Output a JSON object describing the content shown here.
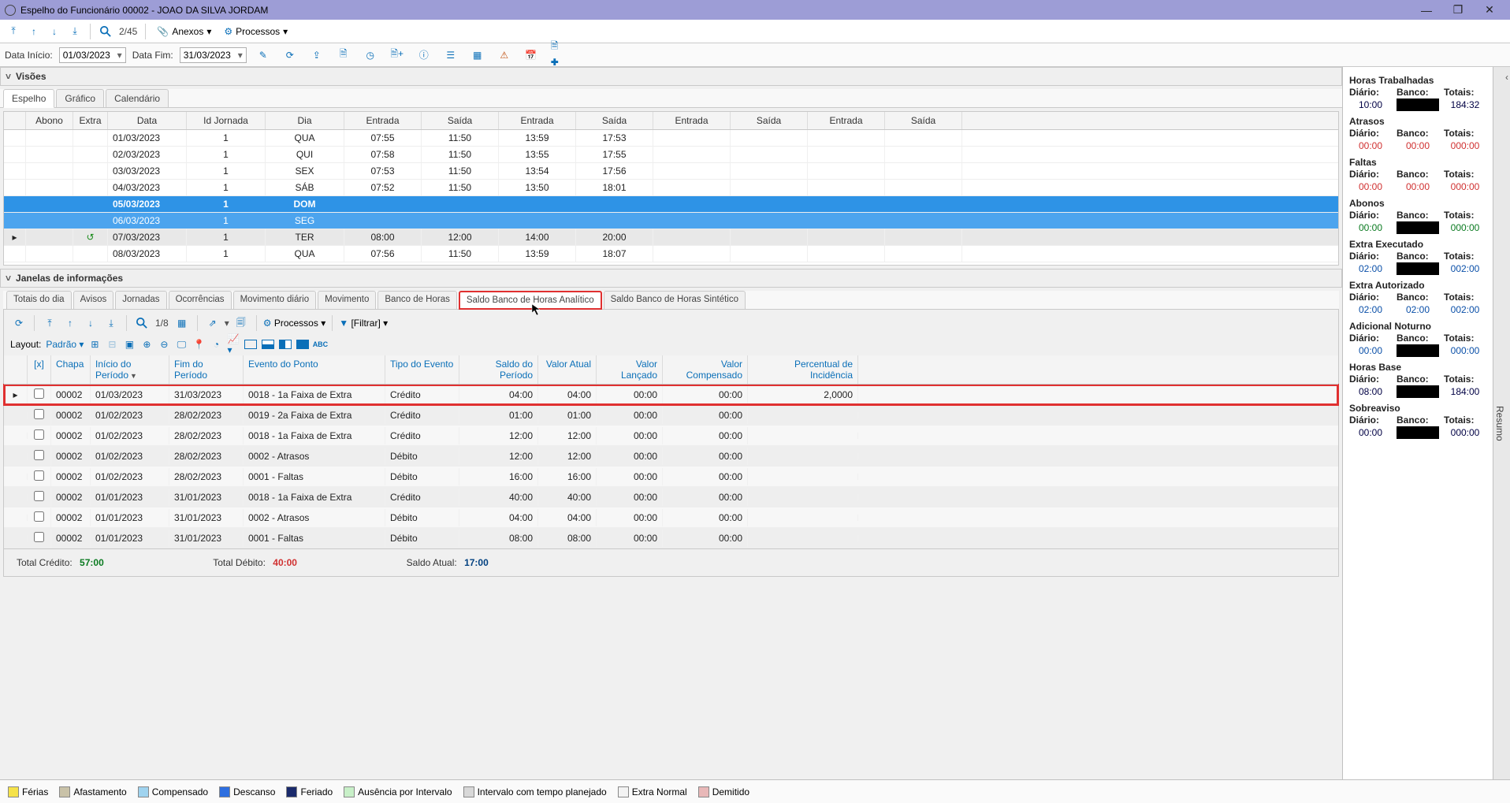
{
  "window": {
    "title": "Espelho do Funcionário 00002 - JOAO DA SILVA JORDAM"
  },
  "nav": {
    "counter": "2/45",
    "anexos": "Anexos",
    "processos": "Processos"
  },
  "dates": {
    "start_label": "Data Início:",
    "start": "01/03/2023",
    "end_label": "Data Fim:",
    "end": "31/03/2023"
  },
  "visoes": {
    "title": "Visões",
    "tabs": [
      "Espelho",
      "Gráfico",
      "Calendário"
    ],
    "columns": [
      "",
      "Abono",
      "Extra",
      "Data",
      "Id Jornada",
      "Dia",
      "Entrada",
      "Saída",
      "Entrada",
      "Saída",
      "Entrada",
      "Saída",
      "Entrada",
      "Saída"
    ],
    "rows": [
      {
        "marker": "",
        "abono": "",
        "extra": "",
        "data": "01/03/2023",
        "id": "1",
        "dia": "QUA",
        "t": [
          "07:55",
          "11:50",
          "13:59",
          "17:53",
          "",
          "",
          "",
          ""
        ]
      },
      {
        "marker": "",
        "abono": "",
        "extra": "",
        "data": "02/03/2023",
        "id": "1",
        "dia": "QUI",
        "t": [
          "07:58",
          "11:50",
          "13:55",
          "17:55",
          "",
          "",
          "",
          ""
        ]
      },
      {
        "marker": "",
        "abono": "",
        "extra": "",
        "data": "03/03/2023",
        "id": "1",
        "dia": "SEX",
        "t": [
          "07:53",
          "11:50",
          "13:54",
          "17:56",
          "",
          "",
          "",
          ""
        ]
      },
      {
        "marker": "",
        "abono": "",
        "extra": "",
        "data": "04/03/2023",
        "id": "1",
        "dia": "SÁB",
        "t": [
          "07:52",
          "11:50",
          "13:50",
          "18:01",
          "",
          "",
          "",
          ""
        ]
      },
      {
        "marker": "",
        "abono": "",
        "extra": "",
        "data": "05/03/2023",
        "id": "1",
        "dia": "DOM",
        "t": [
          "",
          "",
          "",
          "",
          "",
          "",
          "",
          ""
        ],
        "sel": 1
      },
      {
        "marker": "",
        "abono": "",
        "extra": "",
        "data": "06/03/2023",
        "id": "1",
        "dia": "SEG",
        "t": [
          "",
          "",
          "",
          "",
          "",
          "",
          "",
          ""
        ],
        "sel": 2
      },
      {
        "marker": "▸",
        "abono": "",
        "extra": "ico",
        "data": "07/03/2023",
        "id": "1",
        "dia": "TER",
        "t": [
          "08:00",
          "12:00",
          "14:00",
          "20:00",
          "",
          "",
          "",
          ""
        ],
        "cur": 1
      },
      {
        "marker": "",
        "abono": "",
        "extra": "",
        "data": "08/03/2023",
        "id": "1",
        "dia": "QUA",
        "t": [
          "07:56",
          "11:50",
          "13:59",
          "18:07",
          "",
          "",
          "",
          ""
        ]
      }
    ]
  },
  "janelas": {
    "title": "Janelas de informações",
    "tabs": [
      "Totais do dia",
      "Avisos",
      "Jornadas",
      "Ocorrências",
      "Movimento diário",
      "Movimento",
      "Banco de Horas",
      "Saldo Banco de Horas Analítico",
      "Saldo Banco de Horas Sintético"
    ],
    "active_tab": 7
  },
  "btoolbar": {
    "counter": "1/8",
    "processos": "Processos",
    "filtrar": "[Filtrar]",
    "layout_label": "Layout:",
    "layout_value": "Padrão"
  },
  "bgrid": {
    "columns": [
      "[x]",
      "Chapa",
      "Início do Período",
      "Fim do Período",
      "Evento do Ponto",
      "Tipo do Evento",
      "Saldo do Período",
      "Valor Atual",
      "Valor Lançado",
      "Valor Compensado",
      "Percentual de Incidência"
    ],
    "rows": [
      {
        "hi": 1,
        "chapa": "00002",
        "ini": "01/03/2023",
        "fim": "31/03/2023",
        "ev": "0018 - 1a Faixa de Extra",
        "tipo": "Crédito",
        "sp": "04:00",
        "va": "04:00",
        "vl": "00:00",
        "vc": "00:00",
        "pi": "2,0000"
      },
      {
        "chapa": "00002",
        "ini": "01/02/2023",
        "fim": "28/02/2023",
        "ev": "0019 - 2a Faixa de Extra",
        "tipo": "Crédito",
        "sp": "01:00",
        "va": "01:00",
        "vl": "00:00",
        "vc": "00:00",
        "pi": ""
      },
      {
        "chapa": "00002",
        "ini": "01/02/2023",
        "fim": "28/02/2023",
        "ev": "0018 - 1a Faixa de Extra",
        "tipo": "Crédito",
        "sp": "12:00",
        "va": "12:00",
        "vl": "00:00",
        "vc": "00:00",
        "pi": ""
      },
      {
        "chapa": "00002",
        "ini": "01/02/2023",
        "fim": "28/02/2023",
        "ev": "0002 - Atrasos",
        "tipo": "Débito",
        "sp": "12:00",
        "va": "12:00",
        "vl": "00:00",
        "vc": "00:00",
        "pi": ""
      },
      {
        "chapa": "00002",
        "ini": "01/02/2023",
        "fim": "28/02/2023",
        "ev": "0001 - Faltas",
        "tipo": "Débito",
        "sp": "16:00",
        "va": "16:00",
        "vl": "00:00",
        "vc": "00:00",
        "pi": ""
      },
      {
        "chapa": "00002",
        "ini": "01/01/2023",
        "fim": "31/01/2023",
        "ev": "0018 - 1a Faixa de Extra",
        "tipo": "Crédito",
        "sp": "40:00",
        "va": "40:00",
        "vl": "00:00",
        "vc": "00:00",
        "pi": ""
      },
      {
        "chapa": "00002",
        "ini": "01/01/2023",
        "fim": "31/01/2023",
        "ev": "0002 - Atrasos",
        "tipo": "Débito",
        "sp": "04:00",
        "va": "04:00",
        "vl": "00:00",
        "vc": "00:00",
        "pi": ""
      },
      {
        "chapa": "00002",
        "ini": "01/01/2023",
        "fim": "31/01/2023",
        "ev": "0001 - Faltas",
        "tipo": "Débito",
        "sp": "08:00",
        "va": "08:00",
        "vl": "00:00",
        "vc": "00:00",
        "pi": ""
      }
    ],
    "totals": {
      "credito_label": "Total Crédito:",
      "credito": "57:00",
      "debito_label": "Total Débito:",
      "debito": "40:00",
      "saldo_label": "Saldo Atual:",
      "saldo": "17:00"
    }
  },
  "summary_labels": {
    "diario": "Diário:",
    "banco": "Banco:",
    "totais": "Totais:"
  },
  "summary": [
    {
      "title": "Horas Trabalhadas",
      "d": "10:00",
      "b": "BLACK",
      "t": "184:32",
      "cls": [
        "v-norm",
        "v-black",
        "v-norm"
      ]
    },
    {
      "title": "Atrasos",
      "d": "00:00",
      "b": "00:00",
      "t": "000:00",
      "cls": [
        "v-red",
        "v-red",
        "v-red"
      ]
    },
    {
      "title": "Faltas",
      "d": "00:00",
      "b": "00:00",
      "t": "000:00",
      "cls": [
        "v-red",
        "v-red",
        "v-red"
      ]
    },
    {
      "title": "Abonos",
      "d": "00:00",
      "b": "BLACK",
      "t": "000:00",
      "cls": [
        "v-green",
        "v-black",
        "v-green"
      ]
    },
    {
      "title": "Extra Executado",
      "d": "02:00",
      "b": "BLACK",
      "t": "002:00",
      "cls": [
        "v-blue",
        "v-black",
        "v-blue"
      ]
    },
    {
      "title": "Extra Autorizado",
      "d": "02:00",
      "b": "02:00",
      "t": "002:00",
      "cls": [
        "v-blue",
        "v-blue",
        "v-blue"
      ]
    },
    {
      "title": "Adicional Noturno",
      "d": "00:00",
      "b": "BLACK",
      "t": "000:00",
      "cls": [
        "v-blue",
        "v-black",
        "v-blue"
      ]
    },
    {
      "title": "Horas Base",
      "d": "08:00",
      "b": "BLACK",
      "t": "184:00",
      "cls": [
        "v-norm",
        "v-black",
        "v-norm"
      ]
    },
    {
      "title": "Sobreaviso",
      "d": "00:00",
      "b": "BLACK",
      "t": "000:00",
      "cls": [
        "v-norm",
        "v-black",
        "v-norm"
      ]
    }
  ],
  "resumo_tab": "Resumo",
  "legend": [
    {
      "c": "#f5e24a",
      "l": "Férias"
    },
    {
      "c": "#c9c2a8",
      "l": "Afastamento"
    },
    {
      "c": "#9fd3ef",
      "l": "Compensado"
    },
    {
      "c": "#2e6fe0",
      "l": "Descanso"
    },
    {
      "c": "#1a2a6b",
      "l": "Feriado"
    },
    {
      "c": "#c8f0c8",
      "l": "Ausência por Intervalo"
    },
    {
      "c": "#d8d8d8",
      "l": "Intervalo com tempo planejado"
    },
    {
      "c": "#f3f3f3",
      "l": "Extra Normal"
    },
    {
      "c": "#e8b8b8",
      "l": "Demitido"
    }
  ]
}
